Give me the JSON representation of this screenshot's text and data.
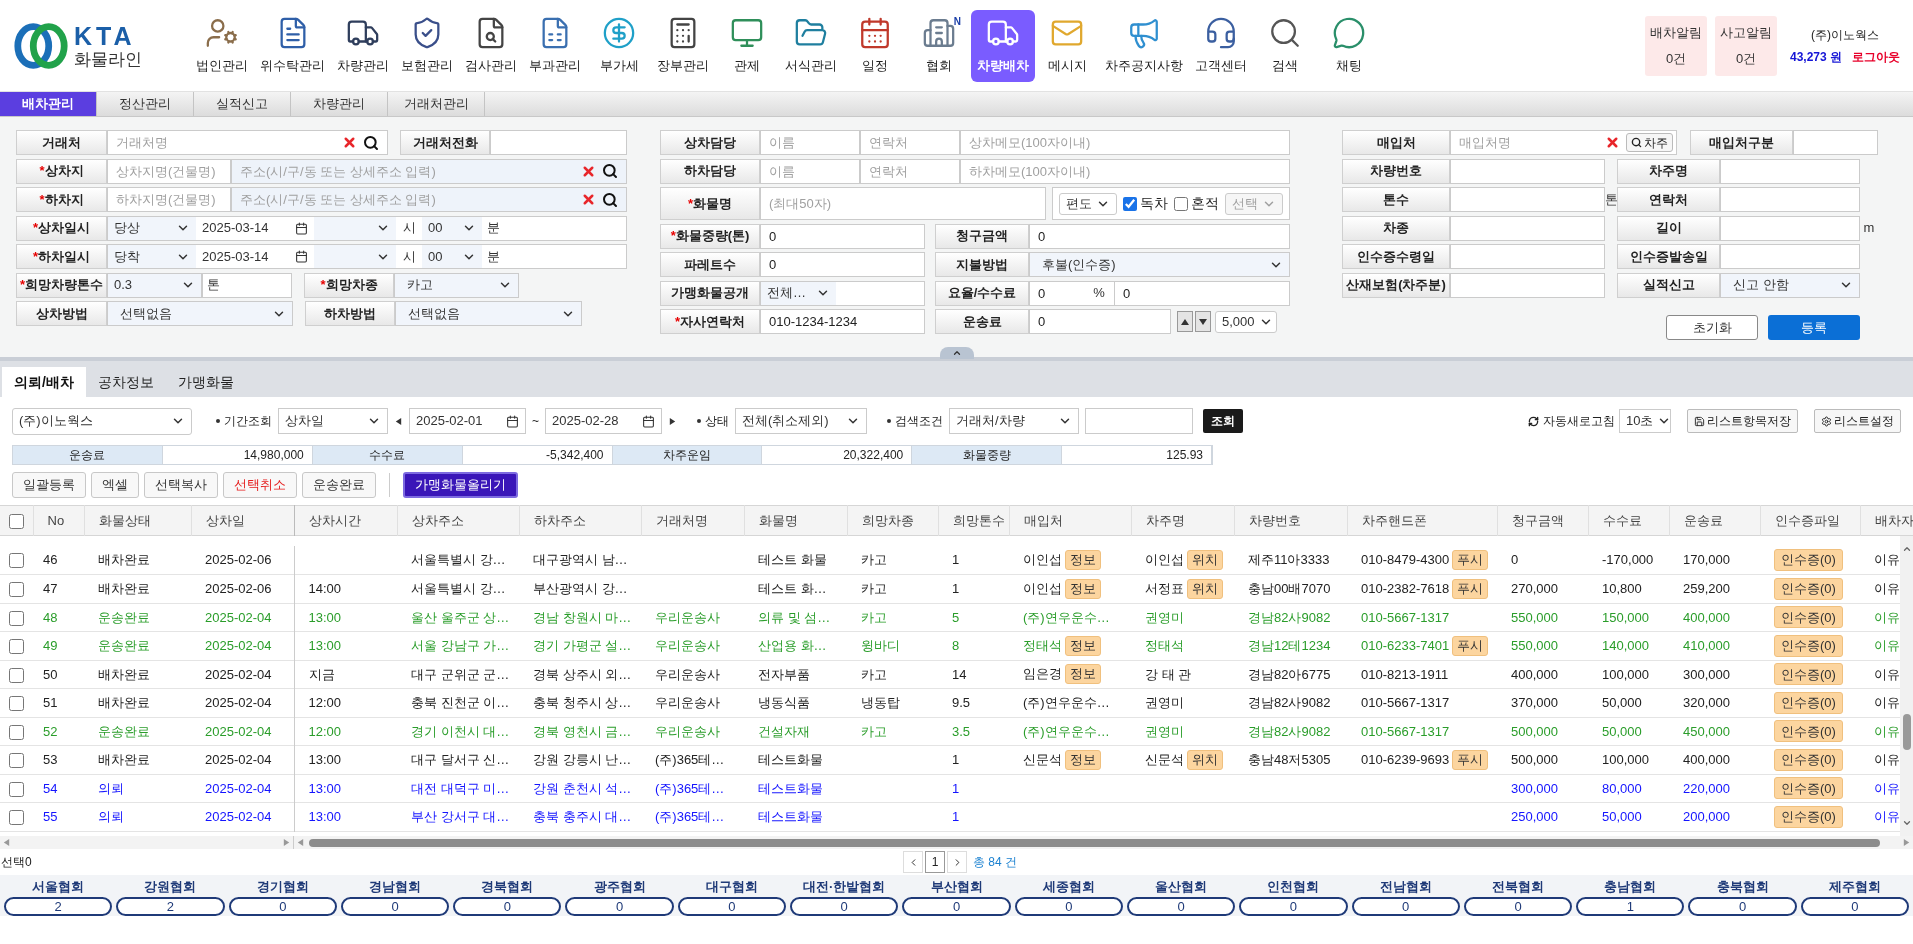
{
  "header": {
    "logo": {
      "brand": "KTA",
      "subtitle": "화물라인"
    },
    "nav": [
      {
        "label": "법인관리",
        "selected": false
      },
      {
        "label": "위수탁관리",
        "selected": false
      },
      {
        "label": "차량관리",
        "selected": false
      },
      {
        "label": "보험관리",
        "selected": false
      },
      {
        "label": "검사관리",
        "selected": false
      },
      {
        "label": "부과관리",
        "selected": false
      },
      {
        "label": "부가세",
        "selected": false
      },
      {
        "label": "장부관리",
        "selected": false
      },
      {
        "label": "관제",
        "selected": false
      },
      {
        "label": "서식관리",
        "selected": false
      },
      {
        "label": "일정",
        "selected": false
      },
      {
        "label": "협회",
        "selected": false,
        "badge": "N"
      },
      {
        "label": "차량배차",
        "selected": true
      },
      {
        "label": "메시지",
        "selected": false
      },
      {
        "label": "차주공지사항",
        "selected": false
      },
      {
        "label": "고객센터",
        "selected": false
      },
      {
        "label": "검색",
        "selected": false
      },
      {
        "label": "채팅",
        "selected": false
      }
    ],
    "alerts": [
      {
        "label": "배차알림",
        "count": "0건"
      },
      {
        "label": "사고알림",
        "count": "0건"
      }
    ],
    "user": {
      "company": "(주)이노웍스",
      "balance": "43,273 원",
      "logout": "로그아웃"
    }
  },
  "sub_tabs": [
    {
      "label": "배차관리",
      "selected": true
    },
    {
      "label": "정산관리",
      "selected": false
    },
    {
      "label": "실적신고",
      "selected": false
    },
    {
      "label": "차량관리",
      "selected": false
    },
    {
      "label": "거래처관리",
      "selected": false
    }
  ],
  "form": {
    "client": {
      "label": "거래처",
      "placeholder": "거래처명"
    },
    "client_phone": {
      "label": "거래처전화"
    },
    "pickup": {
      "label": "상차지",
      "marker": "*",
      "name_placeholder": "상차지명(건물명)",
      "address_placeholder": "주소(시/구/동 또는 상세주소 입력)"
    },
    "dropoff": {
      "label": "하차지",
      "marker": "*",
      "name_placeholder": "하차지명(건물명)",
      "address_placeholder": "주소(시/구/동 또는 상세주소 입력)"
    },
    "pickup_time": {
      "label": "상차일시",
      "marker": "*",
      "day": "당상",
      "date": "2025-03-14",
      "hour_unit": "시",
      "minute": "00",
      "minute_unit": "분"
    },
    "dropoff_time": {
      "label": "하차일시",
      "marker": "*",
      "day": "당착",
      "date": "2025-03-14",
      "hour_unit": "시",
      "minute": "00",
      "minute_unit": "분"
    },
    "tonnage": {
      "label": "희망차량톤수",
      "marker": "*",
      "value": "0.3",
      "unit": "톤"
    },
    "vehicle_type": {
      "label": "희망차종",
      "marker": "*",
      "value": "카고"
    },
    "load_method": {
      "label": "상차방법",
      "value": "선택없음"
    },
    "unload_method": {
      "label": "하차방법",
      "value": "선택없음"
    },
    "pickup_contact": {
      "label": "상차담당",
      "name_placeholder": "이름",
      "phone_placeholder": "연락처",
      "memo_placeholder": "상차메모(100자이내)"
    },
    "dropoff_contact": {
      "label": "하차담당",
      "name_placeholder": "이름",
      "phone_placeholder": "연락처",
      "memo_placeholder": "하차메모(100자이내)"
    },
    "cargo": {
      "label": "화물명",
      "marker": "*",
      "placeholder": "(최대50자)",
      "trip": "편도",
      "options": [
        {
          "label": "독차",
          "checked": true
        },
        {
          "label": "혼적",
          "checked": false
        }
      ],
      "mix_select": {
        "value": "선택",
        "disabled": true
      }
    },
    "weight": {
      "label": "화물중량(톤)",
      "marker": "*",
      "value": "0"
    },
    "billing": {
      "label": "청구금액",
      "value": "0"
    },
    "pallets": {
      "label": "파레트수",
      "value": "0"
    },
    "payment": {
      "label": "지불방법",
      "value": "후불(인수증)"
    },
    "franchise_public": {
      "label": "가맹화물공개",
      "value": "전체…"
    },
    "rate": {
      "label": "요율/수수료",
      "rate": "0",
      "unit": "%",
      "fee": "0"
    },
    "company_phone": {
      "label": "자사연락처",
      "marker": "*",
      "value": "010-1234-1234"
    },
    "freight": {
      "label": "운송료",
      "value": "0",
      "step": "5,000"
    },
    "buyer": {
      "label": "매입처",
      "placeholder": "매입처명",
      "button": "차주"
    },
    "buyer_type": {
      "label": "매입처구분"
    },
    "vehicle_rows": [
      {
        "left": {
          "label": "차량번호",
          "kind": "input"
        },
        "right": {
          "label": "차주명",
          "kind": "input"
        }
      },
      {
        "left": {
          "label": "톤수",
          "kind": "input",
          "unit": "톤"
        },
        "right": {
          "label": "연락처",
          "kind": "input"
        }
      },
      {
        "left": {
          "label": "차종",
          "kind": "input"
        },
        "right": {
          "label": "길이",
          "kind": "input",
          "unit": "m"
        }
      },
      {
        "left": {
          "label": "인수증수령일",
          "kind": "input"
        },
        "right": {
          "label": "인수증발송일",
          "kind": "input"
        }
      },
      {
        "left": {
          "label": "산재보험(차주분)",
          "kind": "input"
        },
        "right": {
          "label": "실적신고",
          "kind": "select",
          "value": "신고 안함"
        }
      }
    ],
    "buttons": [
      {
        "label": "초기화",
        "kind": "secondary"
      },
      {
        "label": "등록",
        "kind": "primary"
      }
    ]
  },
  "list_tabs": [
    {
      "label": "의뢰/배차",
      "selected": true
    },
    {
      "label": "공차정보",
      "selected": false
    },
    {
      "label": "가맹화물",
      "selected": false
    }
  ],
  "toolbar": {
    "company": "(주)이노웍스",
    "period": {
      "label": "기간조회",
      "field": "상차일",
      "from": "2025-02-01",
      "sep": "~",
      "to": "2025-02-28"
    },
    "status": {
      "label": "상태",
      "value": "전체(취소제외)"
    },
    "search": {
      "label": "검색조건",
      "field": "거래처/차량",
      "button": "조회"
    },
    "refresh": {
      "label": "자동새로고침",
      "interval": "10초"
    },
    "buttons": [
      "리스트항목저장",
      "리스트설정"
    ]
  },
  "summary": [
    {
      "label": "운송료",
      "value": "14,980,000"
    },
    {
      "label": "수수료",
      "value": "-5,342,400"
    },
    {
      "label": "차주운임",
      "value": "20,322,400"
    },
    {
      "label": "화물중량",
      "value": "125.93"
    }
  ],
  "actions": [
    {
      "label": "일괄등록",
      "kind": "normal"
    },
    {
      "label": "엑셀",
      "kind": "normal"
    },
    {
      "label": "선택복사",
      "kind": "normal"
    },
    {
      "label": "선택취소",
      "kind": "danger"
    },
    {
      "label": "운송완료",
      "kind": "normal"
    },
    {
      "label": "가맹화물올리기",
      "kind": "primary"
    }
  ],
  "table": {
    "all_selected": false,
    "columns": [
      "No",
      "화물상태",
      "상차일",
      "상차시간",
      "상차주소",
      "하차주소",
      "거래처명",
      "화물명",
      "희망차종",
      "희망톤수",
      "매입처",
      "차주명",
      "차량번호",
      "차주핸드폰",
      "청구금액",
      "수수료",
      "운송료",
      "인수증파일",
      "배차자"
    ],
    "rows": [
      {
        "selected": false,
        "kind": "dispatched",
        "no": "46",
        "status": "배차완료",
        "date": "2025-02-06",
        "from": "서울특별시 강…",
        "to": "대구광역시 남…",
        "cargo": "테스트 화물",
        "vtype": "카고",
        "tons": "1",
        "buyer": "이인섭",
        "buyer_btn": "정보",
        "owner": "이인섭",
        "owner_btn": "위치",
        "plate": "제주11아3333",
        "phone": "010-8479-4300",
        "phone_btn": "푸시",
        "billing": "0",
        "fee": "-170,000",
        "freight": "170,000",
        "receipt": "인수증(0)",
        "dispatcher": "이유"
      },
      {
        "selected": false,
        "kind": "dispatched",
        "no": "47",
        "status": "배차완료",
        "date": "2025-02-06",
        "time": "14:00",
        "from": "서울특별시 강…",
        "to": "부산광역시 강…",
        "cargo": "테스트 화…",
        "vtype": "카고",
        "tons": "1",
        "buyer": "이인섭",
        "buyer_btn": "정보",
        "owner": "서정표",
        "owner_btn": "위치",
        "plate": "충남00배7070",
        "phone": "010-2382-7618",
        "phone_btn": "푸시",
        "billing": "270,000",
        "fee": "10,800",
        "freight": "259,200",
        "receipt": "인수증(0)",
        "dispatcher": "이유"
      },
      {
        "selected": false,
        "kind": "delivered",
        "no": "48",
        "status": "운송완료",
        "date": "2025-02-04",
        "time": "13:00",
        "from": "울산 울주군 상…",
        "to": "경남 창원시 마…",
        "client": "우리운송사",
        "cargo": "의류 및 섬…",
        "vtype": "카고",
        "tons": "5",
        "buyer": "(주)연우운수…",
        "owner": "권영미",
        "plate": "경남82사9082",
        "phone": "010-5667-1317",
        "billing": "550,000",
        "fee": "150,000",
        "freight": "400,000",
        "receipt": "인수증(0)",
        "dispatcher": "이유"
      },
      {
        "selected": false,
        "kind": "delivered",
        "no": "49",
        "status": "운송완료",
        "date": "2025-02-04",
        "time": "13:00",
        "from": "서울 강남구 가…",
        "to": "경기 가평군 설…",
        "client": "우리운송사",
        "cargo": "산업용 화…",
        "vtype": "윙바디",
        "tons": "8",
        "buyer": "정태석",
        "buyer_btn": "정보",
        "owner": "정태석",
        "plate": "경남12테1234",
        "phone": "010-6233-7401",
        "phone_btn": "푸시",
        "billing": "550,000",
        "fee": "140,000",
        "freight": "410,000",
        "receipt": "인수증(0)",
        "dispatcher": "이유"
      },
      {
        "selected": false,
        "kind": "dispatched",
        "no": "50",
        "status": "배차완료",
        "date": "2025-02-04",
        "time": "지금",
        "from": "대구 군위군 군…",
        "to": "경북 상주시 외…",
        "client": "우리운송사",
        "cargo": "전자부품",
        "vtype": "카고",
        "tons": "14",
        "buyer": "임은경",
        "buyer_btn": "정보",
        "owner": "강 태 관",
        "plate": "경남82아6775",
        "phone": "010-8213-1911",
        "billing": "400,000",
        "fee": "100,000",
        "freight": "300,000",
        "receipt": "인수증(0)",
        "dispatcher": "이유"
      },
      {
        "selected": false,
        "kind": "dispatched",
        "no": "51",
        "status": "배차완료",
        "date": "2025-02-04",
        "time": "12:00",
        "from": "충북 진천군 이…",
        "to": "충북 청주시 상…",
        "client": "우리운송사",
        "cargo": "냉동식품",
        "vtype": "냉동탑",
        "tons": "9.5",
        "buyer": "(주)연우운수…",
        "owner": "권영미",
        "plate": "경남82사9082",
        "phone": "010-5667-1317",
        "billing": "370,000",
        "fee": "50,000",
        "freight": "320,000",
        "receipt": "인수증(0)",
        "dispatcher": "이유"
      },
      {
        "selected": false,
        "kind": "delivered",
        "no": "52",
        "status": "운송완료",
        "date": "2025-02-04",
        "time": "12:00",
        "from": "경기 이천시 대…",
        "to": "경북 영천시 금…",
        "client": "우리운송사",
        "cargo": "건설자재",
        "vtype": "카고",
        "tons": "3.5",
        "buyer": "(주)연우운수…",
        "owner": "권영미",
        "plate": "경남82사9082",
        "phone": "010-5667-1317",
        "billing": "500,000",
        "fee": "50,000",
        "freight": "450,000",
        "receipt": "인수증(0)",
        "dispatcher": "이유"
      },
      {
        "selected": false,
        "kind": "dispatched",
        "no": "53",
        "status": "배차완료",
        "date": "2025-02-04",
        "time": "13:00",
        "from": "대구 달서구 신…",
        "to": "강원 강릉시 난…",
        "client": "(주)365테…",
        "cargo": "테스트화물",
        "tons": "1",
        "buyer": "신문석",
        "buyer_btn": "정보",
        "owner": "신문석",
        "owner_btn": "위치",
        "plate": "충남48저5305",
        "phone": "010-6239-9693",
        "phone_btn": "푸시",
        "billing": "500,000",
        "fee": "100,000",
        "freight": "400,000",
        "receipt": "인수증(0)",
        "dispatcher": "이유"
      },
      {
        "selected": false,
        "kind": "requested",
        "no": "54",
        "status": "의뢰",
        "date": "2025-02-04",
        "time": "13:00",
        "from": "대전 대덕구 미…",
        "to": "강원 춘천시 석…",
        "client": "(주)365테…",
        "cargo": "테스트화물",
        "tons": "1",
        "billing": "300,000",
        "fee": "80,000",
        "freight": "220,000",
        "receipt": "인수증(0)",
        "dispatcher": "이유"
      },
      {
        "selected": false,
        "kind": "requested",
        "no": "55",
        "status": "의뢰",
        "date": "2025-02-04",
        "time": "13:00",
        "from": "부산 강서구 대…",
        "to": "충북 충주시 대…",
        "client": "(주)365테…",
        "cargo": "테스트화물",
        "tons": "1",
        "billing": "250,000",
        "fee": "50,000",
        "freight": "200,000",
        "receipt": "인수증(0)",
        "dispatcher": "이유"
      }
    ]
  },
  "footer": {
    "selection": "선택0",
    "pages": [
      {
        "label": "1",
        "selected": true
      }
    ],
    "total": "총 84 건"
  },
  "associations": [
    {
      "name": "서울협회",
      "count": "2"
    },
    {
      "name": "강원협회",
      "count": "2"
    },
    {
      "name": "경기협회",
      "count": "0"
    },
    {
      "name": "경남협회",
      "count": "0"
    },
    {
      "name": "경북협회",
      "count": "0"
    },
    {
      "name": "광주협회",
      "count": "0"
    },
    {
      "name": "대구협회",
      "count": "0"
    },
    {
      "name": "대전·한밭협회",
      "count": "0"
    },
    {
      "name": "부산협회",
      "count": "0"
    },
    {
      "name": "세종협회",
      "count": "0"
    },
    {
      "name": "울산협회",
      "count": "0"
    },
    {
      "name": "인천협회",
      "count": "0"
    },
    {
      "name": "전남협회",
      "count": "0"
    },
    {
      "name": "전북협회",
      "count": "0"
    },
    {
      "name": "충남협회",
      "count": "1"
    },
    {
      "name": "충북협회",
      "count": "0"
    },
    {
      "name": "제주협회",
      "count": "0"
    }
  ]
}
